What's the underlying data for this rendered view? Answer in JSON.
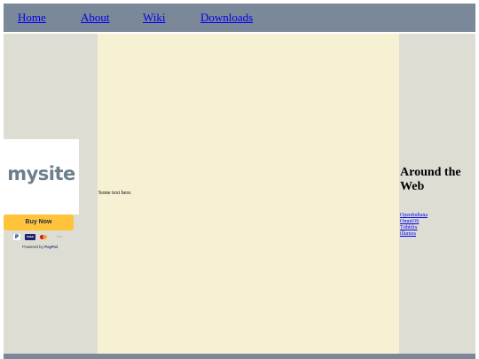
{
  "nav": {
    "items": [
      {
        "label": "Home"
      },
      {
        "label": "About"
      },
      {
        "label": "Wiki"
      },
      {
        "label": "Downloads"
      }
    ]
  },
  "sidebar_left": {
    "logo_text": "mysite",
    "buy_button_label": "Buy Now",
    "payment_icons": [
      "paypal-icon",
      "visa-icon",
      "mastercard-icon",
      "amex-icon"
    ],
    "powered_prefix": "Powered by",
    "powered_brand": "PayPal"
  },
  "main": {
    "text": "Some text here."
  },
  "sidebar_right": {
    "heading": "Around the Web",
    "links": [
      {
        "label": "OpenIndiana"
      },
      {
        "label": "OmniOS"
      },
      {
        "label": "Tribblix"
      },
      {
        "label": "illumos"
      }
    ]
  },
  "colors": {
    "nav_bar": "#7a8899",
    "sidebar_bg": "#deddd4",
    "main_bg": "#f7f1d3",
    "buy_button": "#ffc439",
    "link": "#0000ee"
  }
}
